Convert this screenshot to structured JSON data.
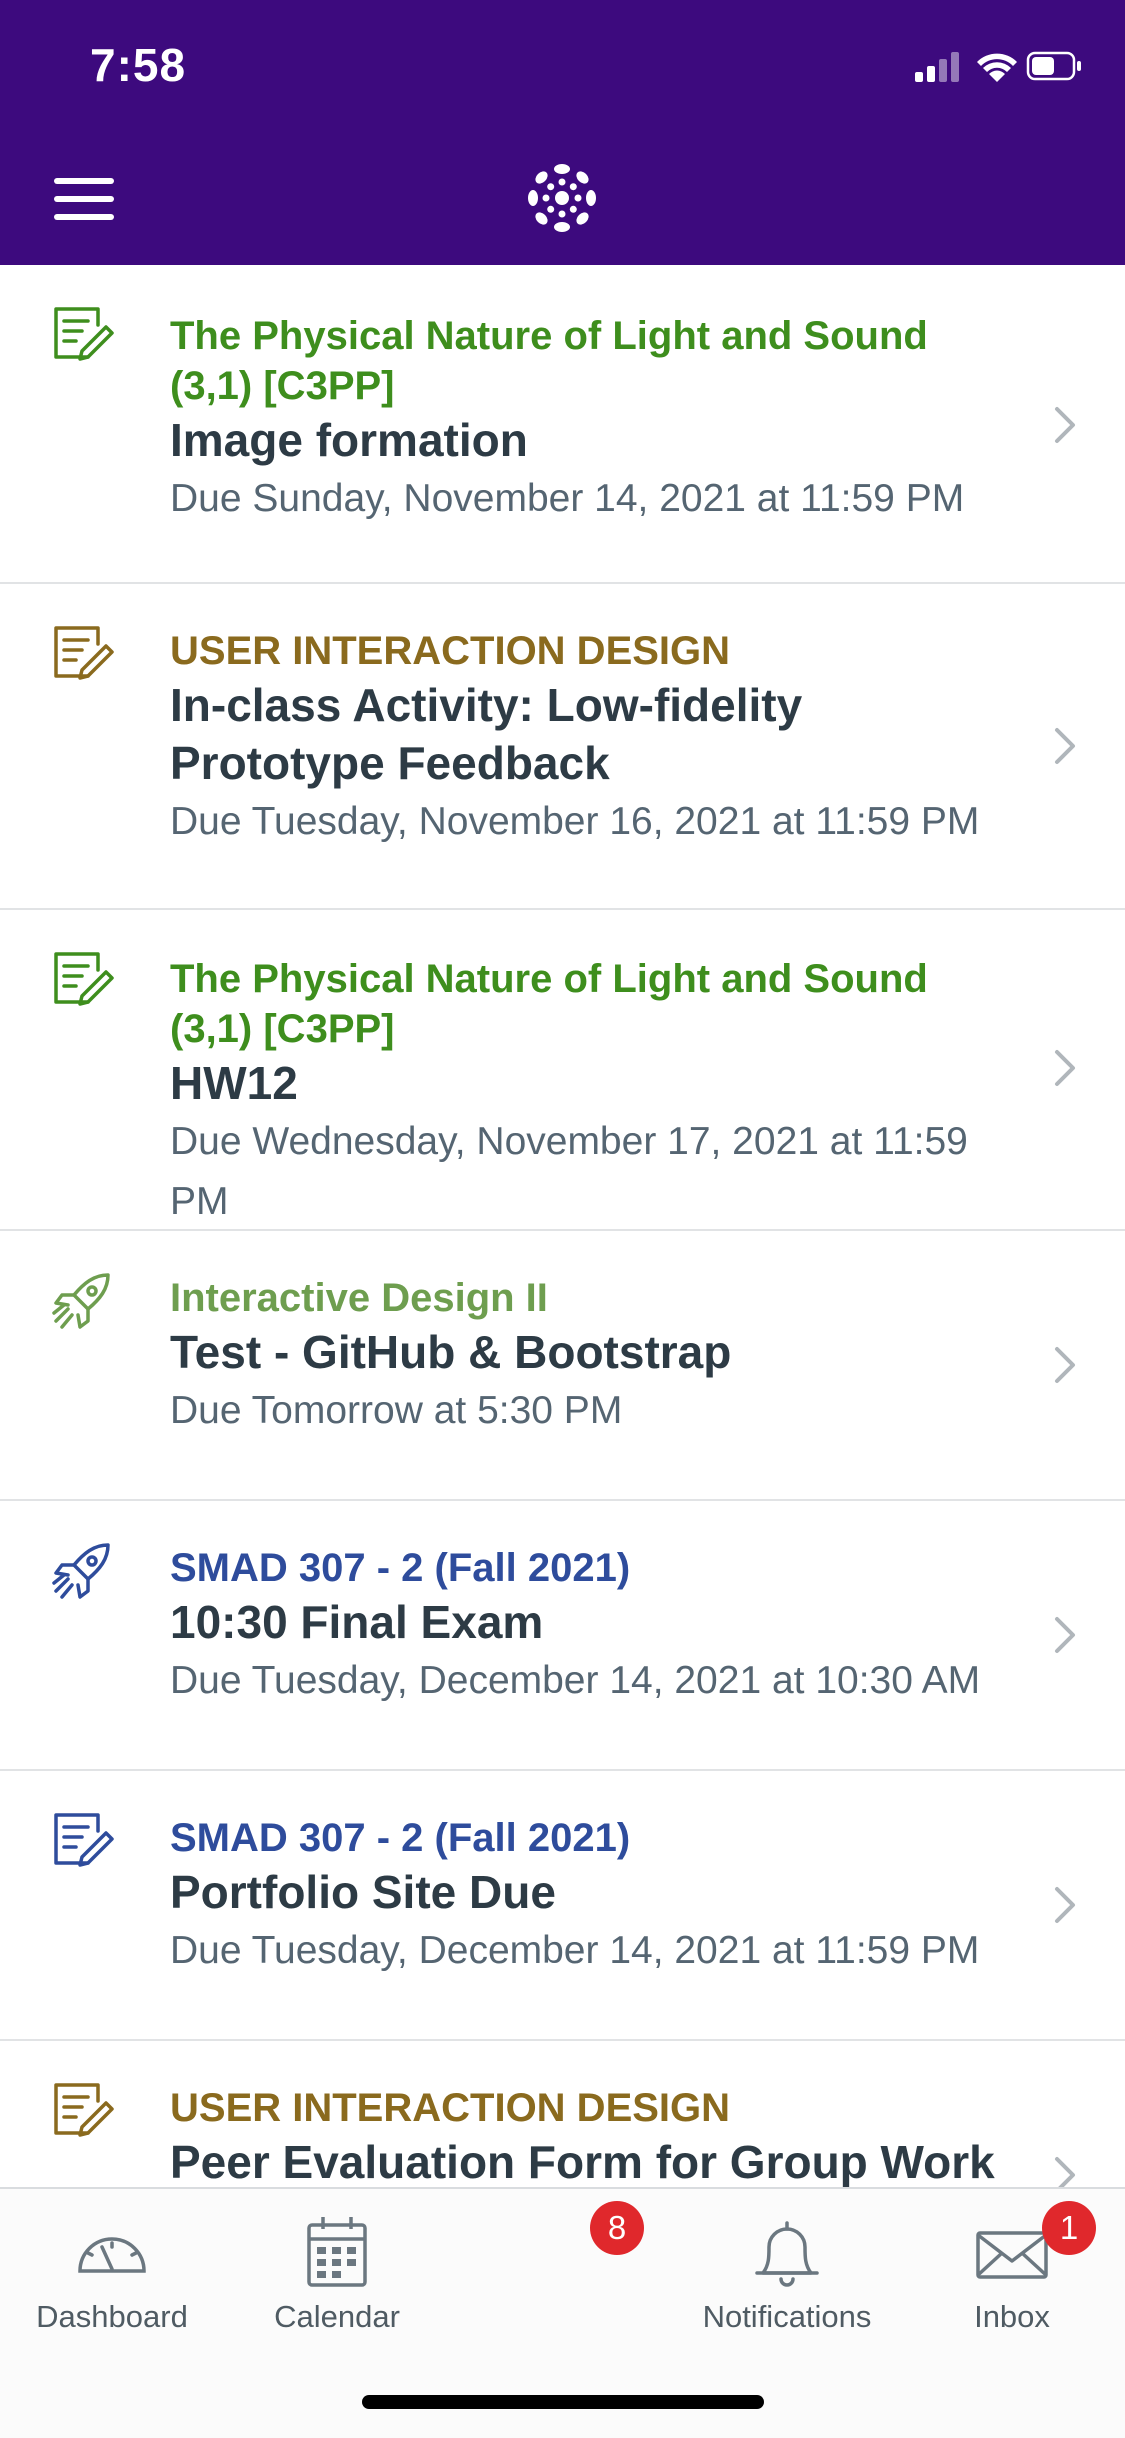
{
  "status": {
    "time": "7:58"
  },
  "colors": {
    "brand_purple": "#3d0a7e",
    "green": "#3e8e1d",
    "gold": "#8a6a1e",
    "light_green": "#6e9e4f",
    "navy": "#2e4c9c",
    "badge_red": "#e0282c"
  },
  "items": [
    {
      "course": "The Physical Nature of Light and Sound (3,1) [C3PP]",
      "title": "Image formation",
      "due": "Due Sunday, November 14, 2021 at 11:59 PM",
      "icon": "assignment-icon",
      "color": "#3e8e1d"
    },
    {
      "course": "USER INTERACTION DESIGN",
      "title": "In-class Activity: Low-fidelity Prototype Feedback",
      "due": "Due Tuesday, November 16, 2021 at 11:59 PM",
      "icon": "assignment-icon",
      "color": "#8a6a1e"
    },
    {
      "course": "The Physical Nature of Light and Sound (3,1) [C3PP]",
      "title": "HW12",
      "due": "Due Wednesday, November 17, 2021 at 11:59 PM",
      "icon": "assignment-icon",
      "color": "#3e8e1d"
    },
    {
      "course": "Interactive Design II",
      "title": "Test - GitHub & Bootstrap",
      "due": "Due Tomorrow at 5:30 PM",
      "icon": "quiz-rocket-icon",
      "color": "#6e9e4f"
    },
    {
      "course": "SMAD 307 - 2 (Fall 2021)",
      "title": "10:30 Final Exam",
      "due": "Due Tuesday, December 14, 2021 at 10:30 AM",
      "icon": "quiz-rocket-icon",
      "color": "#2e4c9c"
    },
    {
      "course": "SMAD 307 - 2 (Fall 2021)",
      "title": "Portfolio Site Due",
      "due": "Due Tuesday, December 14, 2021 at 11:59 PM",
      "icon": "assignment-icon",
      "color": "#2e4c9c"
    },
    {
      "course": "USER INTERACTION DESIGN",
      "title": "Peer Evaluation Form for Group Work",
      "due": "",
      "icon": "assignment-icon",
      "color": "#8a6a1e"
    }
  ],
  "tabs": [
    {
      "label": "Dashboard",
      "icon": "dashboard-icon"
    },
    {
      "label": "Calendar",
      "icon": "calendar-icon"
    },
    {
      "label": "",
      "icon": "todo-icon",
      "badge": "8"
    },
    {
      "label": "Notifications",
      "icon": "bell-icon"
    },
    {
      "label": "Inbox",
      "icon": "mail-icon",
      "badge": "1"
    }
  ]
}
